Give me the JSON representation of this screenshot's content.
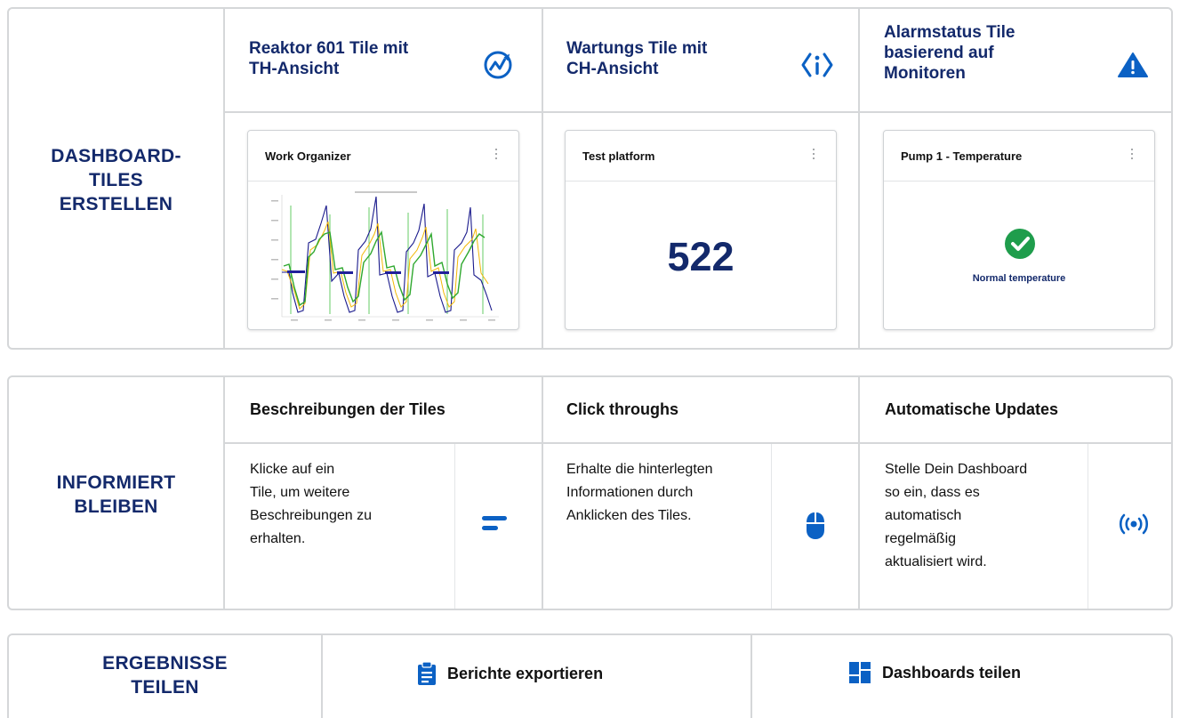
{
  "panel_create": {
    "title": "DASHBOARD-\nTILES\nERSTELLEN",
    "columns": [
      {
        "heading": "Reaktor 601 Tile mit\nTH-Ansicht",
        "icon": "trend-chart-icon",
        "card_title": "Work Organizer",
        "card_menu": "⋮"
      },
      {
        "heading": "Wartungs Tile mit\nCH-Ansicht",
        "icon": "info-icon",
        "card_title": "Test platform",
        "card_menu": "⋮",
        "value": "522"
      },
      {
        "heading": "Alarmstatus Tile\nbasierend auf\nMonitoren",
        "icon": "warning-icon",
        "card_title": "Pump 1 - Temperature",
        "card_menu": "⋮",
        "status": "Normal temperature",
        "status_icon": "check-circle-icon"
      }
    ]
  },
  "panel_inform": {
    "title": "INFORMIERT\nBLEIBEN",
    "columns": [
      {
        "heading": "Beschreibungen der Tiles",
        "text": "Klicke auf ein\nTile, um weitere\nBeschreibungen zu\nerhalten.",
        "icon": "description-lines-icon"
      },
      {
        "heading": "Click throughs",
        "text": "Erhalte die hinterlegten\nInformationen durch\nAnklicken des Tiles.",
        "icon": "mouse-icon"
      },
      {
        "heading": "Automatische Updates",
        "text": "Stelle Dein Dashboard\nso ein, dass es\nautomatisch\nregelmäßig\naktualisiert wird.",
        "icon": "broadcast-icon"
      }
    ]
  },
  "panel_share": {
    "title": "ERGEBNISSE\nTEILEN",
    "items": [
      {
        "label": "Berichte exportieren",
        "icon": "clipboard-icon"
      },
      {
        "label": "Dashboards teilen",
        "icon": "dashboard-grid-icon"
      }
    ]
  },
  "colors": {
    "navy": "#13296b",
    "accent_blue": "#0b61c4",
    "success_green": "#1f9d4c",
    "border": "#d5d7d9"
  }
}
